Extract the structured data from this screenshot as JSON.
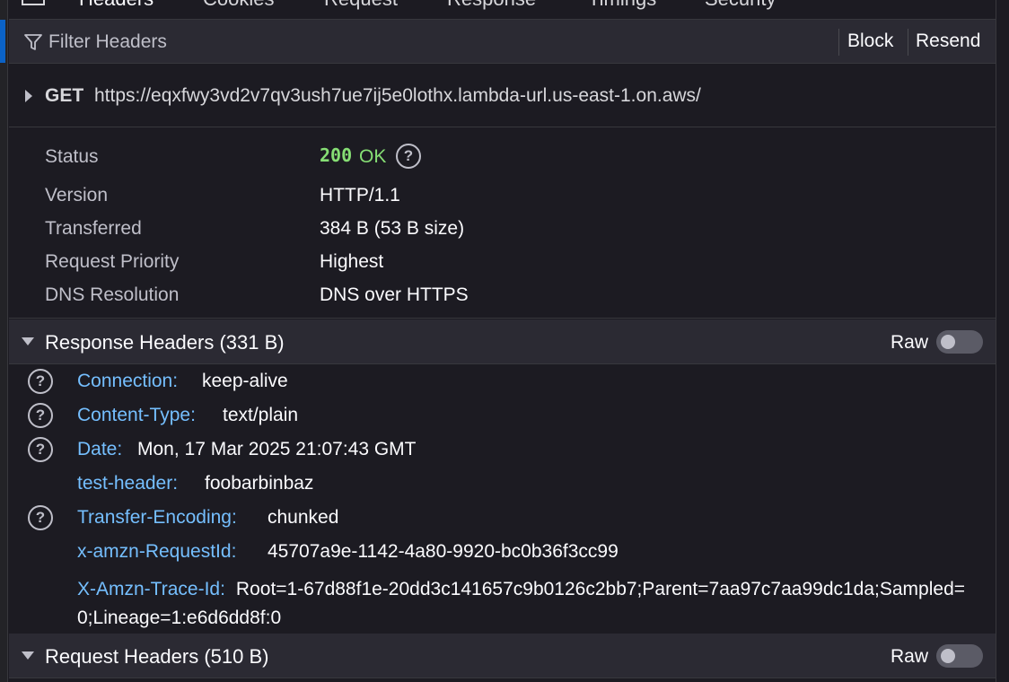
{
  "tabs": [
    {
      "label": "Headers"
    },
    {
      "label": "Cookies"
    },
    {
      "label": "Request"
    },
    {
      "label": "Response"
    },
    {
      "label": "Timings"
    },
    {
      "label": "Security"
    }
  ],
  "filter": {
    "placeholder": "Filter Headers",
    "block_label": "Block",
    "resend_label": "Resend"
  },
  "request": {
    "method": "GET",
    "url": "https://eqxfwy3vd2v7qv3ush7ue7ij5e0lothx.lambda-url.us-east-1.on.aws/"
  },
  "summary": {
    "status_label": "Status",
    "status_code": "200",
    "status_text": "OK",
    "version_label": "Version",
    "version": "HTTP/1.1",
    "transferred_label": "Transferred",
    "transferred": "384 B (53 B size)",
    "priority_label": "Request Priority",
    "priority": "Highest",
    "dns_label": "DNS Resolution",
    "dns": "DNS over HTTPS"
  },
  "response_headers": {
    "title": "Response Headers (331 B)",
    "raw_label": "Raw",
    "raw_enabled": false,
    "items": [
      {
        "name": "Connection:",
        "value": "keep-alive",
        "help": true
      },
      {
        "name": "Content-Type:",
        "value": "text/plain",
        "help": true
      },
      {
        "name": "Date:",
        "value": "Mon, 17 Mar 2025 21:07:43 GMT",
        "help": true
      },
      {
        "name": "test-header:",
        "value": "foobarbinbaz",
        "help": false
      },
      {
        "name": "Transfer-Encoding:",
        "value": "chunked",
        "help": true
      },
      {
        "name": "x-amzn-RequestId:",
        "value": "45707a9e-1142-4a80-9920-bc0b36f3cc99",
        "help": false
      },
      {
        "name": "X-Amzn-Trace-Id:",
        "value": "Root=1-67d88f1e-20dd3c141657c9b0126c2bb7;Parent=7aa97c7aa99dc1da;Sampled=0;Lineage=1:e6d6dd8f:0",
        "help": false
      }
    ]
  },
  "request_headers": {
    "title": "Request Headers (510 B)",
    "raw_label": "Raw",
    "raw_enabled": false
  },
  "colors": {
    "accent": "#0b62c6",
    "status_ok": "#86de74",
    "header_name": "#75bfff"
  },
  "icons": {
    "filter": "filter-icon",
    "help": "help-circle-icon",
    "expand": "triangle-right-icon",
    "collapse": "triangle-down-icon"
  }
}
